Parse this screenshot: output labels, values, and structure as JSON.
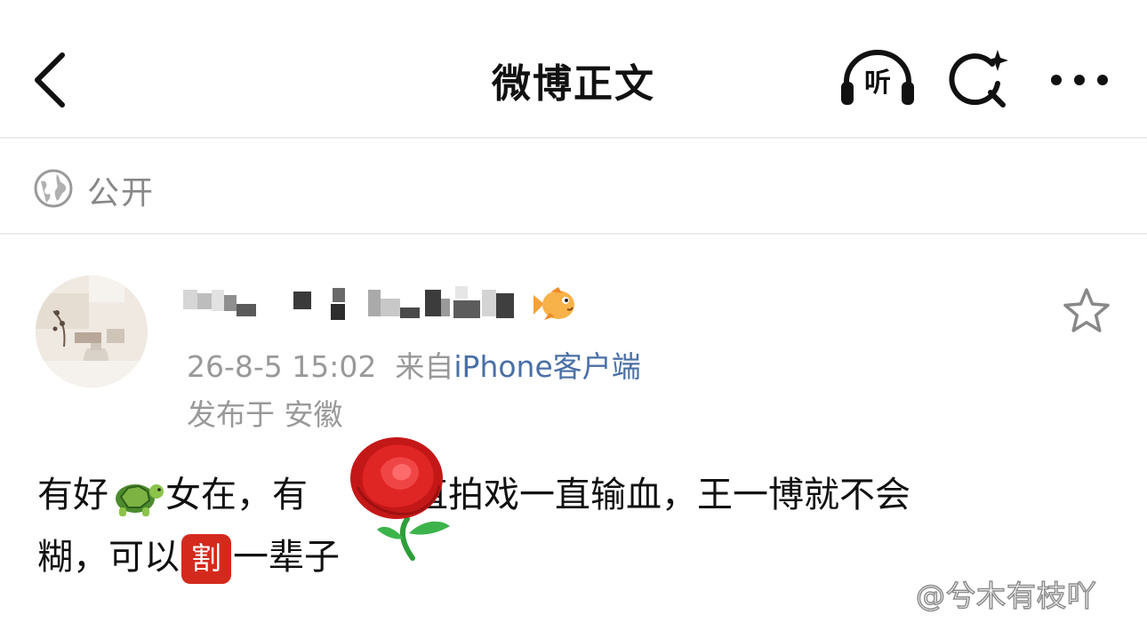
{
  "nav": {
    "title": "微博正文",
    "listen_label": "听",
    "back_icon": "back-arrow-icon",
    "search_icon": "search-sparkle-icon",
    "more_icon": "more-dots-icon"
  },
  "visibility": {
    "icon": "globe-icon",
    "label": "公开"
  },
  "post": {
    "timestamp": "26-8-5 15:02",
    "source_prefix": "来自",
    "source_client": "iPhone客户端",
    "location": "发布于 安徽",
    "body_part1": "有好",
    "body_part2": "女在，有",
    "body_part3": "一直拍戏一直输血，王一博就不会",
    "body_part4": "糊，可以",
    "cut_badge": "割",
    "body_part5": "一辈子"
  },
  "watermark": "@兮木有枝吖",
  "colors": {
    "link": "#4a6fa5",
    "meta": "#999999",
    "divider": "#ececec",
    "badge_red": "#d42a1e"
  }
}
